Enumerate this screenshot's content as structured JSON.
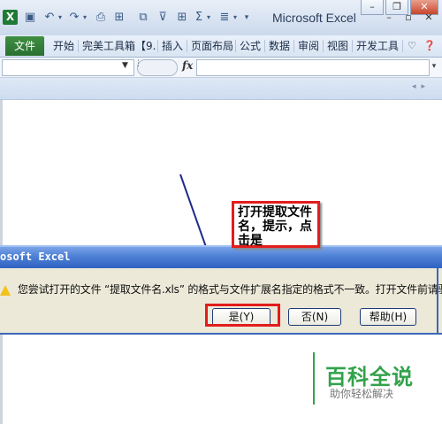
{
  "window": {
    "title": "Microsoft Excel",
    "minimize_icon": "minimize-icon",
    "restore_icon": "restore-icon",
    "close_icon": "close-icon"
  },
  "qat": {
    "logo": "X",
    "icons": [
      "save-icon",
      "undo-icon",
      "redo-icon",
      "print-preview-icon",
      "format-painter-icon",
      "filter-icon",
      "borders-icon",
      "autosum-icon",
      "align-icon",
      "customize-icon"
    ]
  },
  "ribbon": {
    "tabs": [
      "文件",
      "开始",
      "完美工具箱【9.",
      "插入",
      "页面布局",
      "公式",
      "数据",
      "审阅",
      "视图",
      "开发工具"
    ]
  },
  "formula_bar": {
    "fx_label": "fx",
    "namebox_value": "",
    "formula_value": ""
  },
  "dialog": {
    "title": "osoft Excel",
    "message": "您尝试打开的文件 “提取文件名.xls” 的格式与文件扩展名指定的格式不一致。打开文件前请验证",
    "buttons": [
      "是(Y)",
      "否(N)",
      "帮助(H)"
    ]
  },
  "callout": {
    "text": "打开提取文件名，提示，点击是"
  },
  "watermark": {
    "title": "百科全说",
    "subtitle": "助你轻松解决"
  },
  "colors": {
    "highlight": "#e31c1c",
    "dialog_title": "#2f63c2",
    "file_tab": "#2a7031",
    "watermark": "#33a24b"
  }
}
